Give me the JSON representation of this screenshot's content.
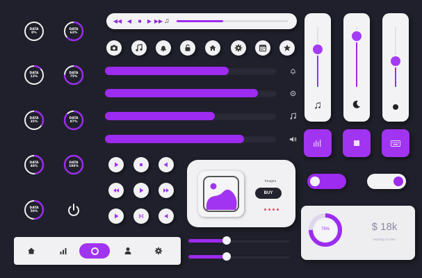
{
  "colors": {
    "background": "#20202c",
    "accent": "#9d2bf0",
    "surface": "#f3f3f5",
    "track": "#2a2a38"
  },
  "gauges": [
    {
      "label": "DATA",
      "value": "0%",
      "percent": 0
    },
    {
      "label": "DATA",
      "value": "63%",
      "percent": 63
    },
    {
      "label": "DATA",
      "value": "13%",
      "percent": 13
    },
    {
      "label": "DATA",
      "value": "75%",
      "percent": 75
    },
    {
      "label": "DATA",
      "value": "35%",
      "percent": 35
    },
    {
      "label": "DATA",
      "value": "87%",
      "percent": 87
    },
    {
      "label": "DATA",
      "value": "48%",
      "percent": 48
    },
    {
      "label": "DATA",
      "value": "100%",
      "percent": 100
    },
    {
      "label": "DATA",
      "value": "50%",
      "percent": 50
    }
  ],
  "music_bar": {
    "controls": [
      "rewind-icon",
      "previous-icon",
      "stop-icon",
      "play-icon",
      "next-icon",
      "music-note-icon"
    ],
    "progress": 0.42
  },
  "icon_row": [
    "camera-icon",
    "music-icon",
    "bell-icon",
    "unlock-icon",
    "home-icon",
    "gear-icon",
    "calendar-icon",
    "star-icon"
  ],
  "progress_bars": [
    {
      "value": 0.72,
      "icon": "bell-icon"
    },
    {
      "value": 0.89,
      "icon": "gear-icon"
    },
    {
      "value": 0.64,
      "icon": "music-icon"
    },
    {
      "value": 0.81,
      "icon": "volume-icon"
    }
  ],
  "vertical_sliders": [
    {
      "value": 0.63,
      "icon": "music-note-icon"
    },
    {
      "value": 0.85,
      "icon": "moon-icon"
    },
    {
      "value": 0.43,
      "icon": "dot-icon"
    }
  ],
  "square_buttons": [
    "equalizer-icon",
    "stop-icon",
    "keyboard-icon"
  ],
  "toggles": [
    {
      "on": false
    },
    {
      "on": true
    }
  ],
  "media_grid": [
    "play-icon",
    "stop-icon",
    "play-left-icon",
    "rewind-icon",
    "play-icon",
    "fast-forward-icon",
    "play-icon",
    "pause-icon",
    "play-icon"
  ],
  "image_card": {
    "caption": "Images",
    "button": "BUY"
  },
  "stat_card": {
    "percent_label": "75%",
    "percent": 75,
    "amount": "$ 18k",
    "subtitle": "Monthly Income"
  },
  "power_button": "power-icon",
  "bottom_nav": [
    "home-icon",
    "chart-icon",
    "toggle-icon",
    "user-icon",
    "settings-icon"
  ],
  "horizontal_sliders": [
    {
      "value": 0.38
    },
    {
      "value": 0.38
    }
  ]
}
